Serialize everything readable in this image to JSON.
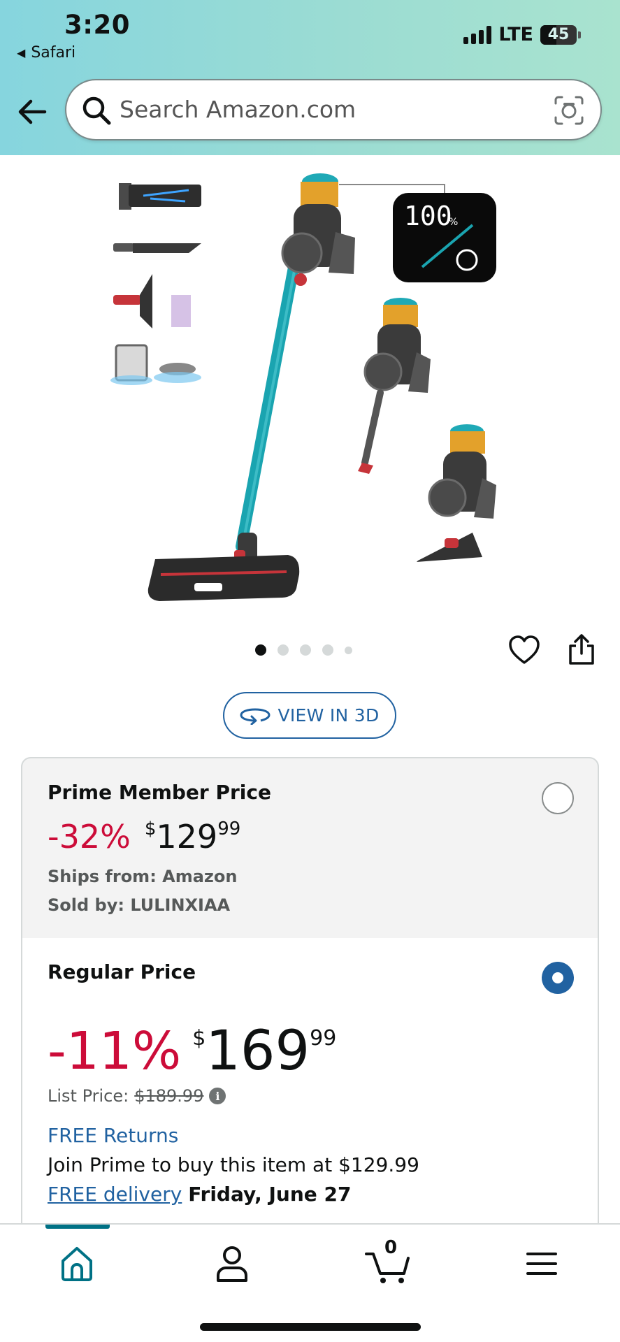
{
  "status_bar": {
    "time": "3:20",
    "back_app": "Safari",
    "network": "LTE",
    "battery": "45"
  },
  "search": {
    "placeholder": "Search Amazon.com"
  },
  "product_image": {
    "display_readout": "100",
    "display_unit": "%",
    "image_count": 5,
    "active_index": 0
  },
  "actions": {
    "view_3d_label": "VIEW IN 3D"
  },
  "prime_option": {
    "title": "Prime Member Price",
    "discount": "-32%",
    "currency": "$",
    "price_whole": "129",
    "price_fraction": "99",
    "ships_from": "Ships from: Amazon",
    "sold_by": "Sold by: LULINXIAA",
    "selected": false
  },
  "regular_option": {
    "title": "Regular Price",
    "discount": "-11%",
    "currency": "$",
    "price_whole": "169",
    "price_fraction": "99",
    "list_price_label": "List Price:",
    "list_price_value": "$189.99",
    "free_returns": "FREE Returns",
    "join_prime": "Join Prime to buy this item at $129.99",
    "delivery_link": "FREE delivery",
    "delivery_date": "Friday, June 27",
    "selected": true
  },
  "tabbar": {
    "cart_count": "0",
    "active_tab": "home"
  },
  "colors": {
    "link": "#2162a1",
    "discount": "#cc0c39",
    "active_tab": "#007185",
    "header_gradient_start": "#86d5de",
    "header_gradient_end": "#a9e3cf"
  }
}
